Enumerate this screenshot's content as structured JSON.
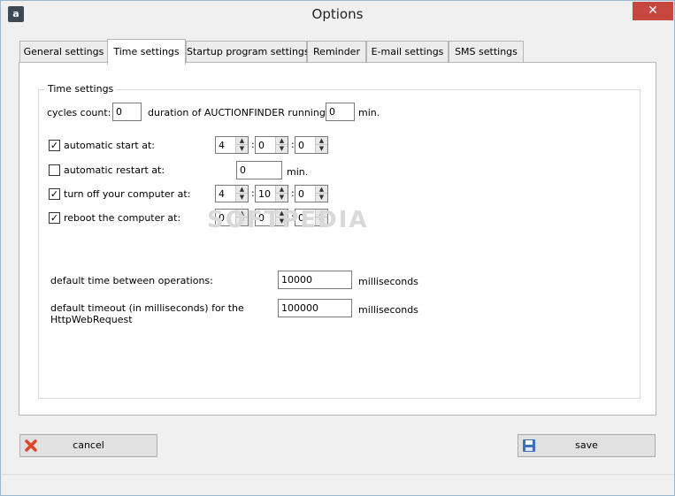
{
  "window": {
    "title": "Options",
    "app_icon": "a",
    "close_glyph": "✕"
  },
  "tabs": [
    {
      "label": "General settings",
      "active": false
    },
    {
      "label": "Time settings",
      "active": true
    },
    {
      "label": "Startup program settings",
      "active": false
    },
    {
      "label": "Reminder",
      "active": false
    },
    {
      "label": "E-mail settings",
      "active": false
    },
    {
      "label": "SMS settings",
      "active": false
    }
  ],
  "time_settings": {
    "group_title": "Time settings",
    "cycles_label": "cycles count:",
    "cycles_value": "0",
    "duration_label": "duration of AUCTIONFINDER running:",
    "duration_value": "0",
    "duration_unit": "min.",
    "automatic_start": {
      "label": "automatic start at:",
      "checked": true,
      "h": "4",
      "m": "0",
      "s": "0"
    },
    "automatic_restart": {
      "label": "automatic restart at:",
      "checked": false,
      "value": "0",
      "unit": "min."
    },
    "turn_off": {
      "label": "turn off your computer at:",
      "checked": true,
      "h": "4",
      "m": "10",
      "s": "0"
    },
    "reboot": {
      "label": "reboot the computer at:",
      "checked": true,
      "h": "0",
      "m": "0",
      "s": "0"
    },
    "time_separator": ":",
    "default_time_label": "default time between operations:",
    "default_time_value": "10000",
    "default_time_unit": "milliseconds",
    "default_timeout_label_1": "default timeout (in milliseconds) for the",
    "default_timeout_label_2": "HttpWebRequest",
    "default_timeout_value": "100000",
    "default_timeout_unit": "milliseconds"
  },
  "watermark": "SOFTPEDIA",
  "footer": {
    "cancel_label": "cancel",
    "save_label": "save"
  },
  "colors": {
    "close_button": "#c7463d",
    "cancel_icon": "#e0442a",
    "save_icon": "#3f6fb5"
  }
}
